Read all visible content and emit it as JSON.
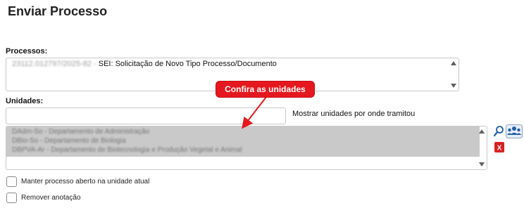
{
  "page": {
    "title": "Enviar Processo"
  },
  "processos": {
    "label": "Processos:",
    "number": "23112.012797/2025-82 -",
    "description": "SEI: Solicitação de Novo Tipo Processo/Documento"
  },
  "unidades": {
    "label": "Unidades:",
    "search_value": "",
    "show_units_label": "Mostrar unidades por onde tramitou",
    "items": [
      "DAdm-So - Departamento de Administração",
      "DBio-So - Departamento de Biologia",
      "DBPVA-Ar - Departamento de Biotecnologia e Produção Vegetal e Animal"
    ]
  },
  "options": {
    "keep_open_label": "Manter processo aberto na unidade atual",
    "remove_annotation_label": "Remover anotação"
  },
  "annotation": {
    "callout_text": "Confira as unidades"
  },
  "icons": {
    "search": "search-icon",
    "select_units": "group-users-icon",
    "remove": "remove-x-icon"
  },
  "colors": {
    "callout": "#e6181f",
    "selected_list_bg": "#c9c9c9",
    "icon_blue": "#1e5fa8"
  }
}
